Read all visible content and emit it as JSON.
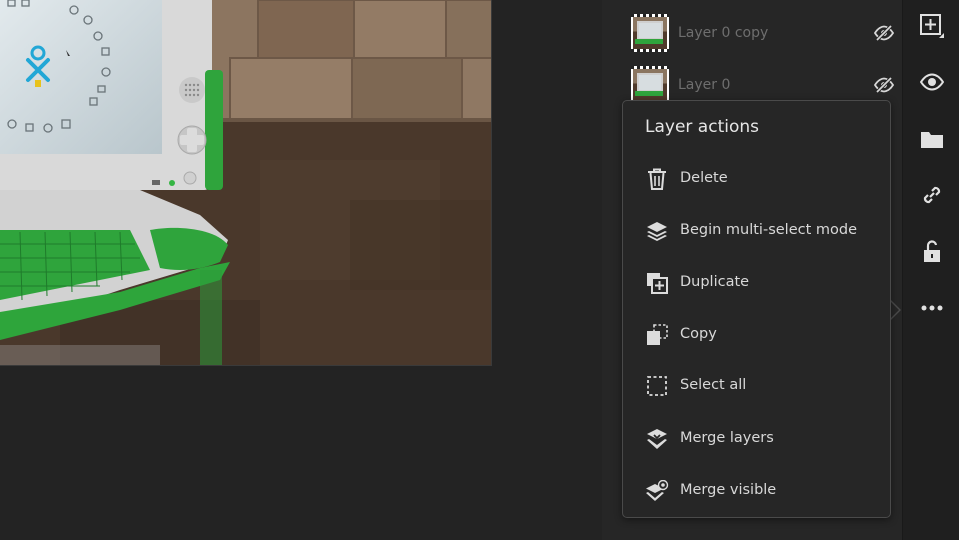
{
  "layers": [
    {
      "name": "Layer 0 copy",
      "visibility_icon": "eye-off-icon"
    },
    {
      "name": "Layer 0",
      "visibility_icon": "eye-off-icon"
    }
  ],
  "popover": {
    "title": "Layer actions",
    "items": [
      {
        "label": "Delete",
        "icon": "trash-icon"
      },
      {
        "label": "Begin multi-select mode",
        "icon": "layers-stack-icon"
      },
      {
        "label": "Duplicate",
        "icon": "duplicate-icon"
      },
      {
        "label": "Copy",
        "icon": "copy-icon"
      },
      {
        "label": "Select all",
        "icon": "select-all-icon"
      },
      {
        "label": "Merge layers",
        "icon": "merge-layers-icon"
      },
      {
        "label": "Merge visible",
        "icon": "merge-visible-icon"
      }
    ]
  },
  "toolbar": [
    {
      "icon": "add-layer-icon"
    },
    {
      "icon": "eye-icon"
    },
    {
      "icon": "folder-icon"
    },
    {
      "icon": "link-icon"
    },
    {
      "icon": "unlock-icon"
    },
    {
      "icon": "more-options-icon"
    }
  ],
  "colors": {
    "background": "#232323",
    "panel": "#262626",
    "toolbar": "#1f1f1f",
    "popover_border": "#4a4a4a",
    "text": "#d8d8d8",
    "muted_text": "#6e6e6e",
    "laptop_green": "#2fa43c"
  }
}
